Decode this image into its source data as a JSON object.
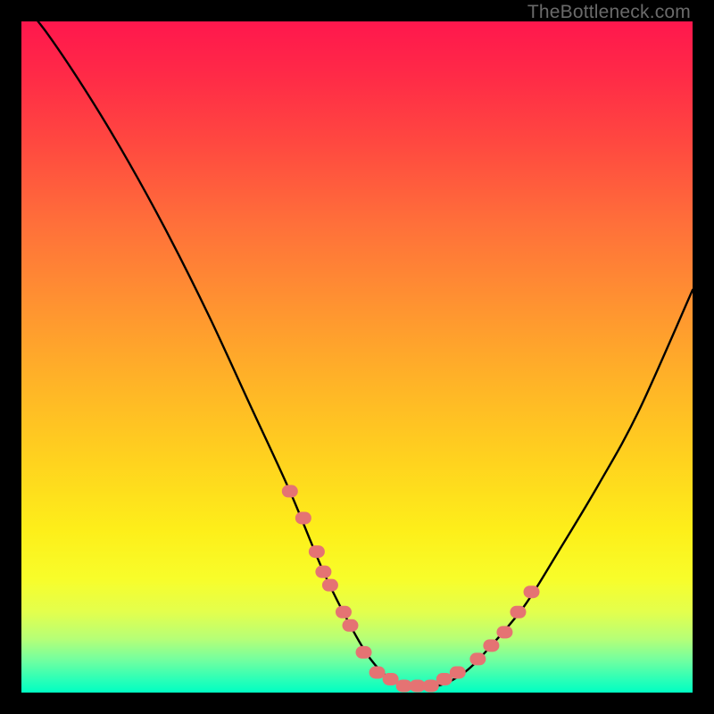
{
  "watermark": "TheBottleneck.com",
  "chart_data": {
    "type": "line",
    "title": "",
    "xlabel": "",
    "ylabel": "",
    "xlim": [
      0,
      100
    ],
    "ylim": [
      0,
      100
    ],
    "grid": false,
    "legend": false,
    "background_gradient": {
      "top": "#ff174d",
      "middle": "#ffd41e",
      "bottom": "#00ffc2"
    },
    "series": [
      {
        "name": "curve",
        "x": [
          0,
          4,
          10,
          16,
          22,
          28,
          34,
          40,
          45,
          49,
          52,
          55,
          58,
          62,
          66,
          70,
          75,
          80,
          86,
          92,
          100
        ],
        "values": [
          103,
          98,
          89,
          79,
          68,
          56,
          43,
          30,
          18,
          10,
          5,
          2,
          1,
          1,
          3,
          7,
          13,
          21,
          31,
          42,
          60
        ]
      }
    ],
    "markers": {
      "name": "highlight-dots",
      "color": "#e57373",
      "x": [
        40,
        42,
        44,
        45,
        46,
        48,
        49,
        51,
        53,
        55,
        57,
        59,
        61,
        63,
        65,
        68,
        70,
        72,
        74,
        76
      ],
      "values": [
        30,
        26,
        21,
        18,
        16,
        12,
        10,
        6,
        3,
        2,
        1,
        1,
        1,
        2,
        3,
        5,
        7,
        9,
        12,
        15
      ]
    }
  }
}
